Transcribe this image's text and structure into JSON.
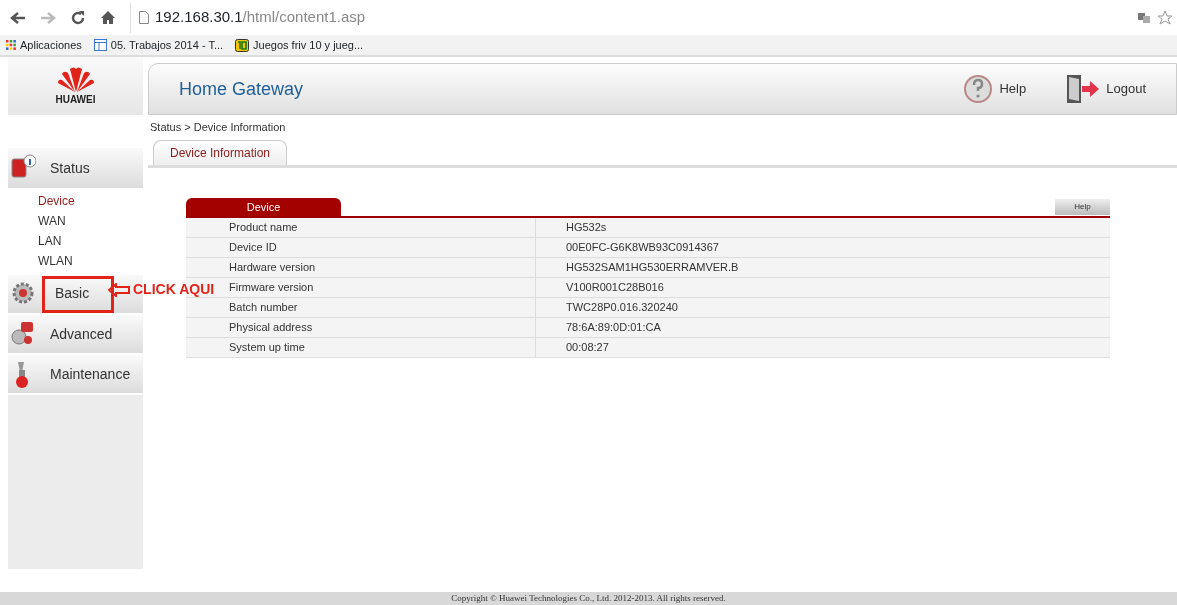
{
  "browser": {
    "url_host": "192.168.30.1",
    "url_path": "/html/content1.asp",
    "bookmarks": [
      {
        "label": "Aplicaciones",
        "kind": "apps"
      },
      {
        "label": "05. Trabajos 2014 - T...",
        "kind": "page"
      },
      {
        "label": "Juegos friv 10 y jueg...",
        "kind": "game"
      }
    ]
  },
  "header": {
    "logo_text": "HUAWEI",
    "title": "Home Gateway",
    "help": "Help",
    "logout": "Logout"
  },
  "breadcrumb": "Status > Device Information",
  "tabs": [
    {
      "label": "Device Information",
      "selected": true
    }
  ],
  "sidebar": [
    {
      "label": "Status",
      "kind": "status",
      "expanded": true,
      "highlighted": false,
      "items": [
        {
          "label": "Device",
          "selected": true
        },
        {
          "label": "WAN",
          "selected": false
        },
        {
          "label": "LAN",
          "selected": false
        },
        {
          "label": "WLAN",
          "selected": false
        }
      ]
    },
    {
      "label": "Basic",
      "kind": "basic",
      "expanded": false,
      "highlighted": true
    },
    {
      "label": "Advanced",
      "kind": "advanced",
      "expanded": false,
      "highlighted": false
    },
    {
      "label": "Maintenance",
      "kind": "maintenance",
      "expanded": false,
      "highlighted": false
    }
  ],
  "annotation": {
    "text": "CLICK AQUI"
  },
  "table": {
    "title": "Device",
    "help": "Help",
    "rows": [
      {
        "label": "Product name",
        "value": "HG532s"
      },
      {
        "label": "Device ID",
        "value": "00E0FC-G6K8WB93C0914367"
      },
      {
        "label": "Hardware version",
        "value": "HG532SAM1HG530ERRAMVER.B"
      },
      {
        "label": "Firmware version",
        "value": "V100R001C28B016"
      },
      {
        "label": "Batch number",
        "value": "TWC28P0.016.320240"
      },
      {
        "label": "Physical address",
        "value": "78:6A:89:0D:01:CA"
      },
      {
        "label": "System up time",
        "value": "00:08:27"
      }
    ]
  },
  "footer": "Copyright © Huawei Technologies Co., Ltd. 2012-2013. All rights reserved."
}
